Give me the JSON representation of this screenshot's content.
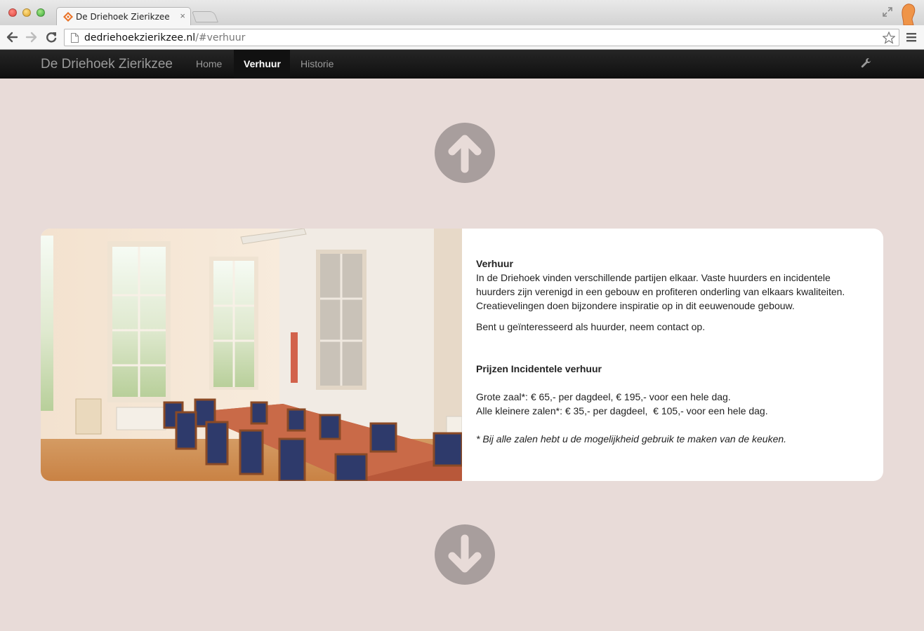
{
  "browser": {
    "tab_title": "De Driehoek Zierikzee",
    "tab_close": "×",
    "url_domain": "dedriehoekzierikzee.nl",
    "url_path": "/#verhuur"
  },
  "navbar": {
    "brand": "De Driehoek Zierikzee",
    "items": [
      {
        "label": "Home",
        "active": false
      },
      {
        "label": "Verhuur",
        "active": true
      },
      {
        "label": "Historie",
        "active": false
      }
    ]
  },
  "section": {
    "heading": "Verhuur",
    "intro": "In de Driehoek vinden verschillende partijen elkaar. Vaste huurders en incidentele huurders zijn verenigd in een gebouw en profiteren onderling van elkaars kwaliteiten. Creatievelingen doen bijzondere inspiratie op in dit eeuwenoude gebouw.",
    "contact": "Bent u geïnteresseerd als huurder, neem contact op.",
    "prices_heading": "Prijzen Incidentele verhuur",
    "price_large": "Grote zaal*: € 65,- per dagdeel, € 195,- voor een hele dag.",
    "price_small": "Alle kleinere zalen*: € 35,- per dagdeel,  € 105,- voor een hele dag.",
    "footnote": "* Bij alle zalen hebt u de mogelijkheid gebruik te maken van de keuken."
  },
  "icons": {
    "arrow_up": "arrow-up-circle-icon",
    "arrow_down": "arrow-down-circle-icon"
  },
  "colors": {
    "page_background": "#e8dbd8",
    "navbar_background": "#1a1a1a",
    "arrow_circle": "#a89e9d",
    "card_background": "#ffffff"
  }
}
